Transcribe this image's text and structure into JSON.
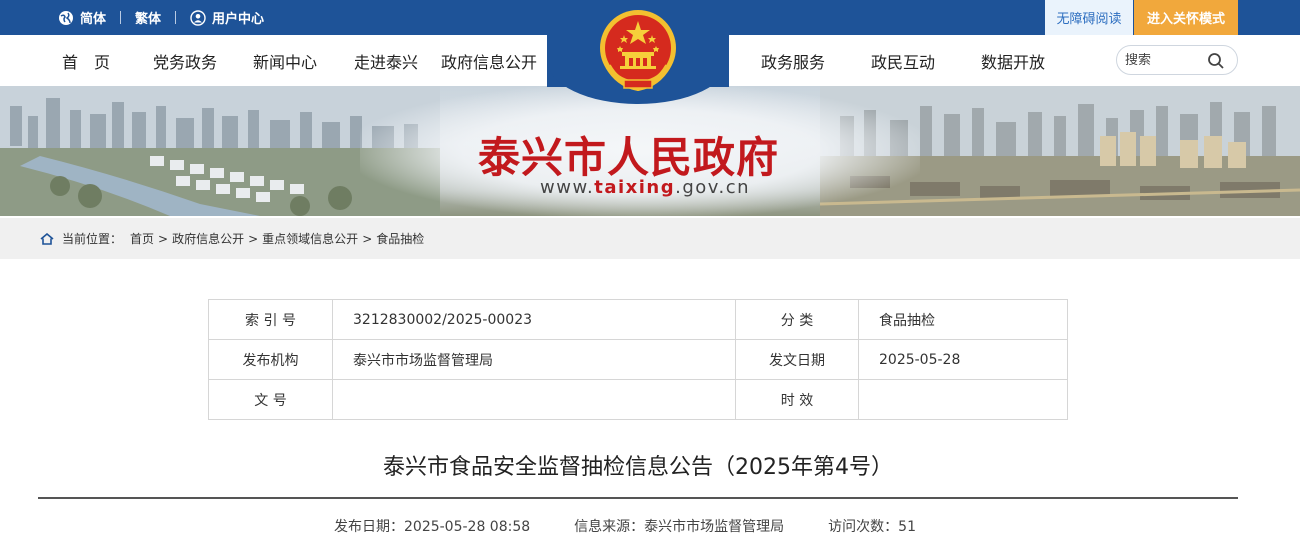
{
  "topbar": {
    "simplified": "简体",
    "traditional": "繁体",
    "user_center": "用户中心",
    "accessibility": "无障碍阅读",
    "care_mode": "进入关怀模式"
  },
  "nav": {
    "items_left": [
      "首　页",
      "党务政务",
      "新闻中心",
      "走进泰兴",
      "政府信息公开"
    ],
    "items_right": [
      "政务服务",
      "政民互动",
      "数据开放"
    ],
    "search_placeholder": "搜索"
  },
  "banner": {
    "site_title": "泰兴市人民政府",
    "url_prefix": "www.",
    "url_domain": "taixing",
    "url_suffix": ".gov.cn"
  },
  "breadcrumb": {
    "label": "当前位置：",
    "items": [
      "首页",
      "政府信息公开",
      "重点领域信息公开",
      "食品抽检"
    ]
  },
  "meta": {
    "index_label": "索 引 号",
    "index_value": "3212830002/2025-00023",
    "category_label": "分 类",
    "category_value": "食品抽检",
    "publisher_label": "发布机构",
    "publisher_value": "泰兴市市场监督管理局",
    "date_label": "发文日期",
    "date_value": "2025-05-28",
    "docno_label": "文 号",
    "docno_value": "",
    "validity_label": "时 效",
    "validity_value": ""
  },
  "article": {
    "title": "泰兴市食品安全监督抽检信息公告（2025年第4号）",
    "publish_date": "发布日期：2025-05-28 08:58",
    "source": "信息来源：泰兴市市场监督管理局",
    "visits": "访问次数：51"
  },
  "colors": {
    "brand_blue": "#1e5398",
    "title_red": "#c2191d",
    "care_orange": "#f1a83c"
  }
}
